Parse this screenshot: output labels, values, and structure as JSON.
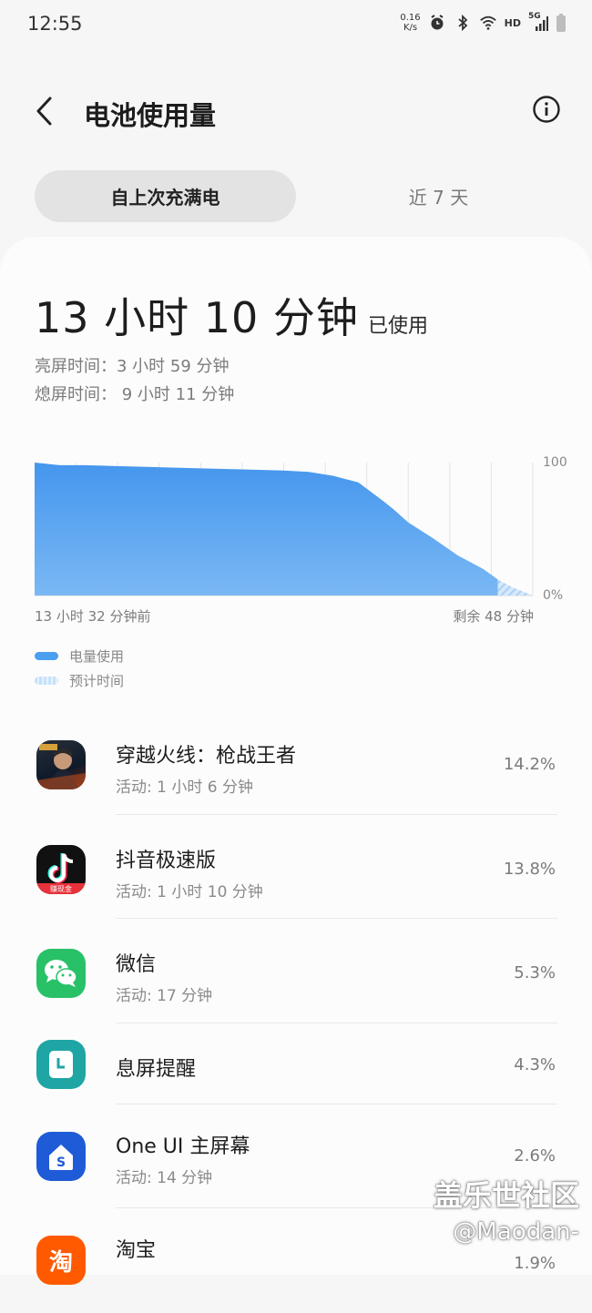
{
  "status": {
    "time": "12:55",
    "net_speed": "0.16",
    "net_unit": "K/s",
    "hd": "HD",
    "net_type": "5G"
  },
  "header": {
    "title": "电池使用量"
  },
  "tabs": [
    {
      "label": "自上次充满电",
      "active": true
    },
    {
      "label": "近 7 天",
      "active": false
    }
  ],
  "summary": {
    "total": "13 小时 10 分钟",
    "used_label": "已使用",
    "screen_on": "亮屏时间：3 小时 59 分钟",
    "screen_off": "熄屏时间： 9 小时 11 分钟"
  },
  "chart_data": {
    "type": "area",
    "x_start_label": "13 小时 32 分钟前",
    "x_end_label": "剩余 48 分钟",
    "y_top_label": "100",
    "y_bottom_label": "0%",
    "ylim": [
      0,
      100
    ],
    "series": [
      {
        "name": "电量使用",
        "x": [
          0,
          0.05,
          0.1,
          0.2,
          0.3,
          0.4,
          0.5,
          0.55,
          0.6,
          0.65,
          0.7,
          0.72,
          0.75,
          0.8,
          0.85,
          0.9,
          0.93
        ],
        "values": [
          100,
          98,
          98,
          97,
          96,
          95,
          94,
          93,
          90,
          85,
          71,
          65,
          55,
          43,
          30,
          20,
          12
        ]
      },
      {
        "name": "预计时间",
        "x": [
          0.93,
          0.96,
          1.0
        ],
        "values": [
          12,
          6,
          0
        ]
      }
    ],
    "colors": {
      "usage": "#4a9ff0",
      "estimate": "#bcdcf8"
    }
  },
  "legend": [
    {
      "label": "电量使用",
      "color": "#4a9ff0"
    },
    {
      "label": "预计时间",
      "color": "#bcdcf8"
    }
  ],
  "apps": [
    {
      "name": "穿越火线：枪战王者",
      "activity": "活动: 1 小时 6 分钟",
      "percent": "14.2%",
      "icon": "crossfire-icon"
    },
    {
      "name": "抖音极速版",
      "activity": "活动: 1 小时 10 分钟",
      "percent": "13.8%",
      "icon": "douyin-lite-icon"
    },
    {
      "name": "微信",
      "activity": "活动: 17 分钟",
      "percent": "5.3%",
      "icon": "wechat-icon"
    },
    {
      "name": "息屏提醒",
      "activity": "",
      "percent": "4.3%",
      "icon": "always-on-display-icon"
    },
    {
      "name": "One UI 主屏幕",
      "activity": "活动: 14 分钟",
      "percent": "2.6%",
      "icon": "oneui-home-icon"
    },
    {
      "name": "淘宝",
      "activity": "",
      "percent": "1.9%",
      "icon": "taobao-icon"
    }
  ],
  "watermark": {
    "line1": "盖乐世社区",
    "line2": "@Maodan-"
  }
}
